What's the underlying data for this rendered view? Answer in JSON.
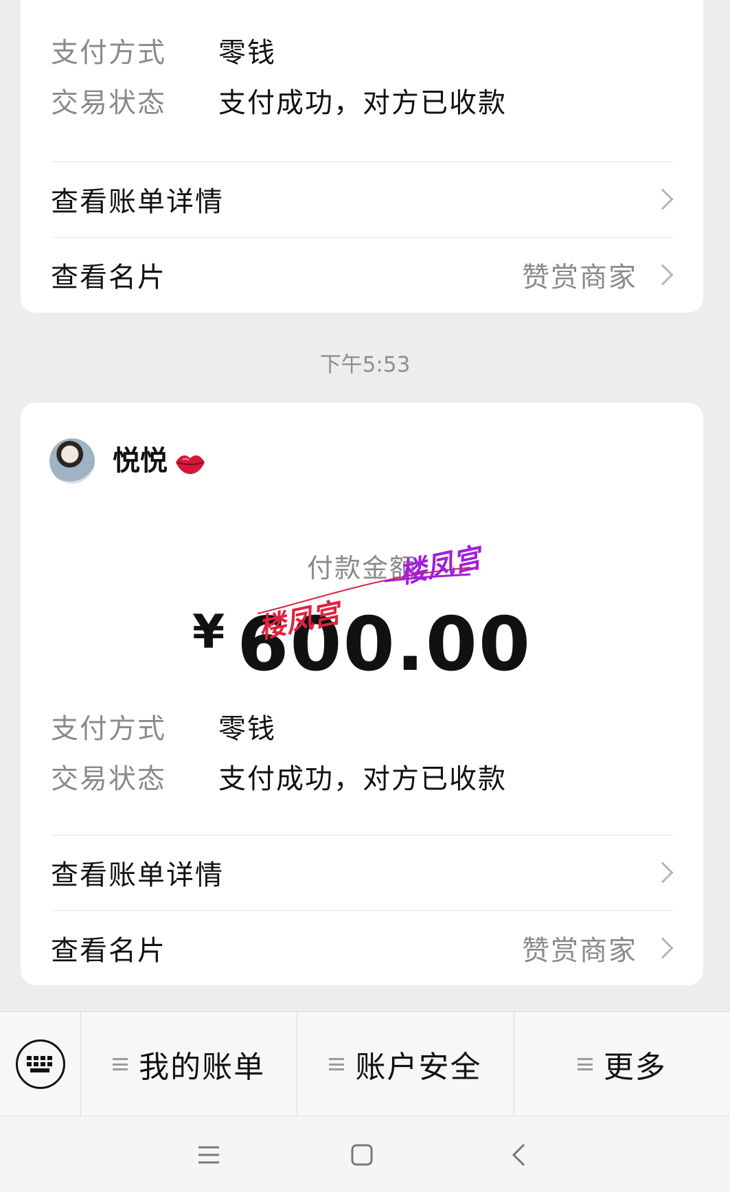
{
  "cards": [
    {
      "rows": [
        {
          "label": "支付方式",
          "value": "零钱"
        },
        {
          "label": "交易状态",
          "value": "支付成功，对方已收款"
        }
      ],
      "links": [
        {
          "label": "查看账单详情",
          "extra": ""
        },
        {
          "label": "查看名片",
          "extra": "赞赏商家"
        }
      ]
    },
    {
      "payee": {
        "name": "悦悦",
        "emoji_icon": "lips-icon"
      },
      "amount_label": "付款金额",
      "currency": "¥",
      "amount": "600.00",
      "rows": [
        {
          "label": "支付方式",
          "value": "零钱"
        },
        {
          "label": "交易状态",
          "value": "支付成功，对方已收款"
        }
      ],
      "links": [
        {
          "label": "查看账单详情",
          "extra": ""
        },
        {
          "label": "查看名片",
          "extra": "赞赏商家"
        }
      ]
    }
  ],
  "timestamp": "下午5:53",
  "watermarks": [
    "楼凤宫",
    "楼凤宫"
  ],
  "menu": {
    "items": [
      {
        "label": "我的账单"
      },
      {
        "label": "账户安全"
      },
      {
        "label": "更多"
      }
    ]
  },
  "colors": {
    "background": "#ededed",
    "card": "#ffffff",
    "label_gray": "#8a8a8a",
    "watermark_red": "#e0223f",
    "watermark_purple": "#a21fd8"
  }
}
